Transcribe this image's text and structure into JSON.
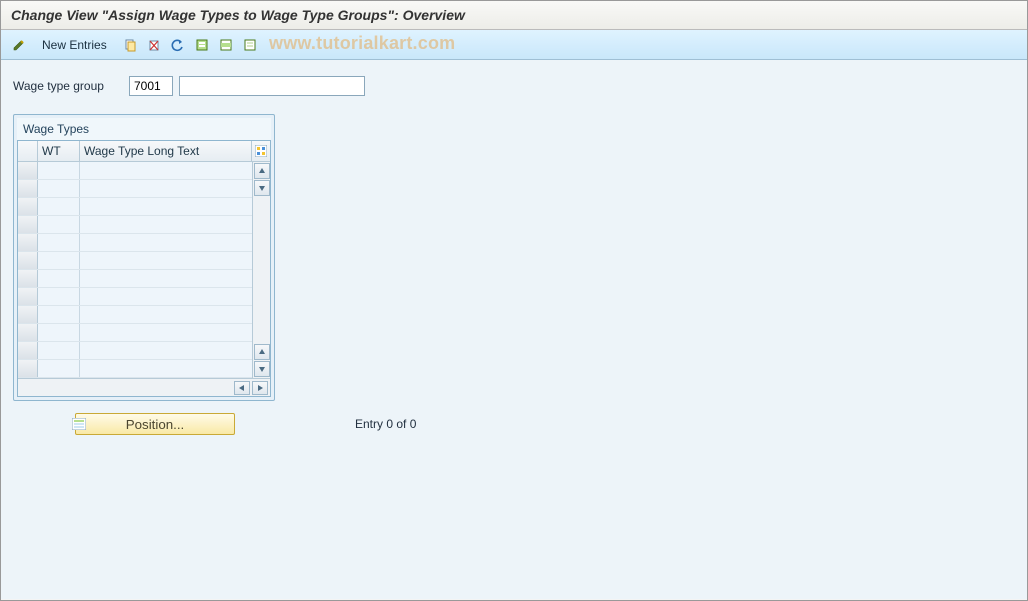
{
  "title": "Change View \"Assign Wage Types to Wage Type Groups\": Overview",
  "toolbar": {
    "new_entries_label": "New Entries",
    "icons": {
      "toggle": "toggle-display-change-icon",
      "copy": "copy-as-icon",
      "delete": "delete-icon",
      "undo": "undo-icon",
      "select_all": "select-all-icon",
      "select_block": "select-block-icon",
      "deselect_all": "deselect-all-icon"
    }
  },
  "watermark": "www.tutorialkart.com",
  "fields": {
    "wage_type_group_label": "Wage type group",
    "wage_type_group_value": "7001",
    "wage_type_group_desc": ""
  },
  "panel": {
    "title": "Wage Types",
    "columns": {
      "wt": "WT",
      "long_text": "Wage Type Long Text"
    }
  },
  "footer": {
    "position_label": "Position...",
    "entry_text": "Entry 0 of 0"
  }
}
